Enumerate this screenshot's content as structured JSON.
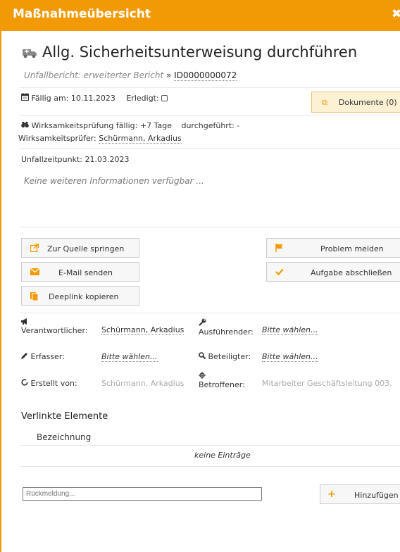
{
  "window": {
    "title": "Maßnahmeübersicht",
    "close_glyph": "✖"
  },
  "header": {
    "icon": "truck-icon",
    "title": "Allg. Sicherheitsunterweisung durchführen",
    "breadcrumb_source": "Unfallbericht: erweiterter Bericht",
    "breadcrumb_sep": "»",
    "breadcrumb_id": "ID0000000072"
  },
  "status": {
    "due_label": "Fällig am:",
    "due_value": "10.11.2023",
    "done_label": "Erledigt:",
    "documents_label": "Dokumente (0)"
  },
  "effectiveness": {
    "check_label": "Wirksamkeitsprüfung fällig:",
    "check_value": "+7 Tage",
    "performed_label": "durchgeführt:",
    "performed_value": "-",
    "checker_label": "Wirksamkeitsprüfer:",
    "checker_value": "Schürmann, Arkadius"
  },
  "incident": {
    "time_label": "Unfallzeitpunkt:",
    "time_value": "21.03.2023",
    "info_text": "Keine weiteren Informationen verfügbar ..."
  },
  "actions": {
    "goto_source": "Zur Quelle springen",
    "send_email": "E-Mail senden",
    "copy_deeplink": "Deeplink kopieren",
    "report_problem": "Problem melden",
    "complete_task": "Aufgabe abschließen"
  },
  "fields": {
    "responsible_label": "Verantwortlicher:",
    "responsible_value": "Schürmann, Arkadius",
    "executor_label": "Ausführender:",
    "executor_value": "Bitte wählen...",
    "recorder_label": "Erfasser:",
    "recorder_value": "Bitte wählen...",
    "participant_label": "Beteiligter:",
    "participant_value": "Bitte wählen...",
    "created_by_label": "Erstellt von:",
    "created_by_value": "Schürmann, Arkadius",
    "affected_label": "Betroffener:",
    "affected_value": "Mitarbeiter Geschäftsleitung 003,"
  },
  "linked": {
    "title": "Verlinkte Elemente",
    "column_header": "Bezeichnung",
    "empty_text": "keine Einträge"
  },
  "feedback": {
    "placeholder": "Rückmeldung...",
    "add_label": "Hinzufügen"
  },
  "colors": {
    "accent": "#f29a06"
  }
}
